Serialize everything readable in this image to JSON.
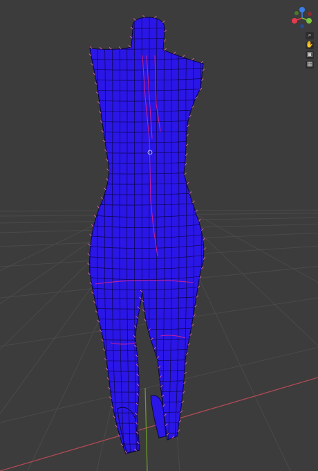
{
  "viewport": {
    "background": "#3c3c3c",
    "grid_color": "#4a4a4a",
    "x_axis_color": "#b04a55",
    "y_axis_color": "#6a9a2a"
  },
  "model": {
    "fill_color": "#2a16e6",
    "edge_color": "#0a0640",
    "seam_color": "#c0209a",
    "vertex_color": "#d060a0"
  },
  "gizmo": {
    "axes": [
      {
        "name": "X",
        "color": "#e83a4e"
      },
      {
        "name": "Y",
        "color": "#7cc43a"
      },
      {
        "name": "Z",
        "color": "#3a7ee8"
      }
    ]
  },
  "nav_buttons": [
    {
      "icon": "zoom-icon",
      "glyph": "⌕"
    },
    {
      "icon": "pan-icon",
      "glyph": "✋"
    },
    {
      "icon": "camera-icon",
      "glyph": "▣"
    },
    {
      "icon": "perspective-icon",
      "glyph": "▦"
    }
  ]
}
